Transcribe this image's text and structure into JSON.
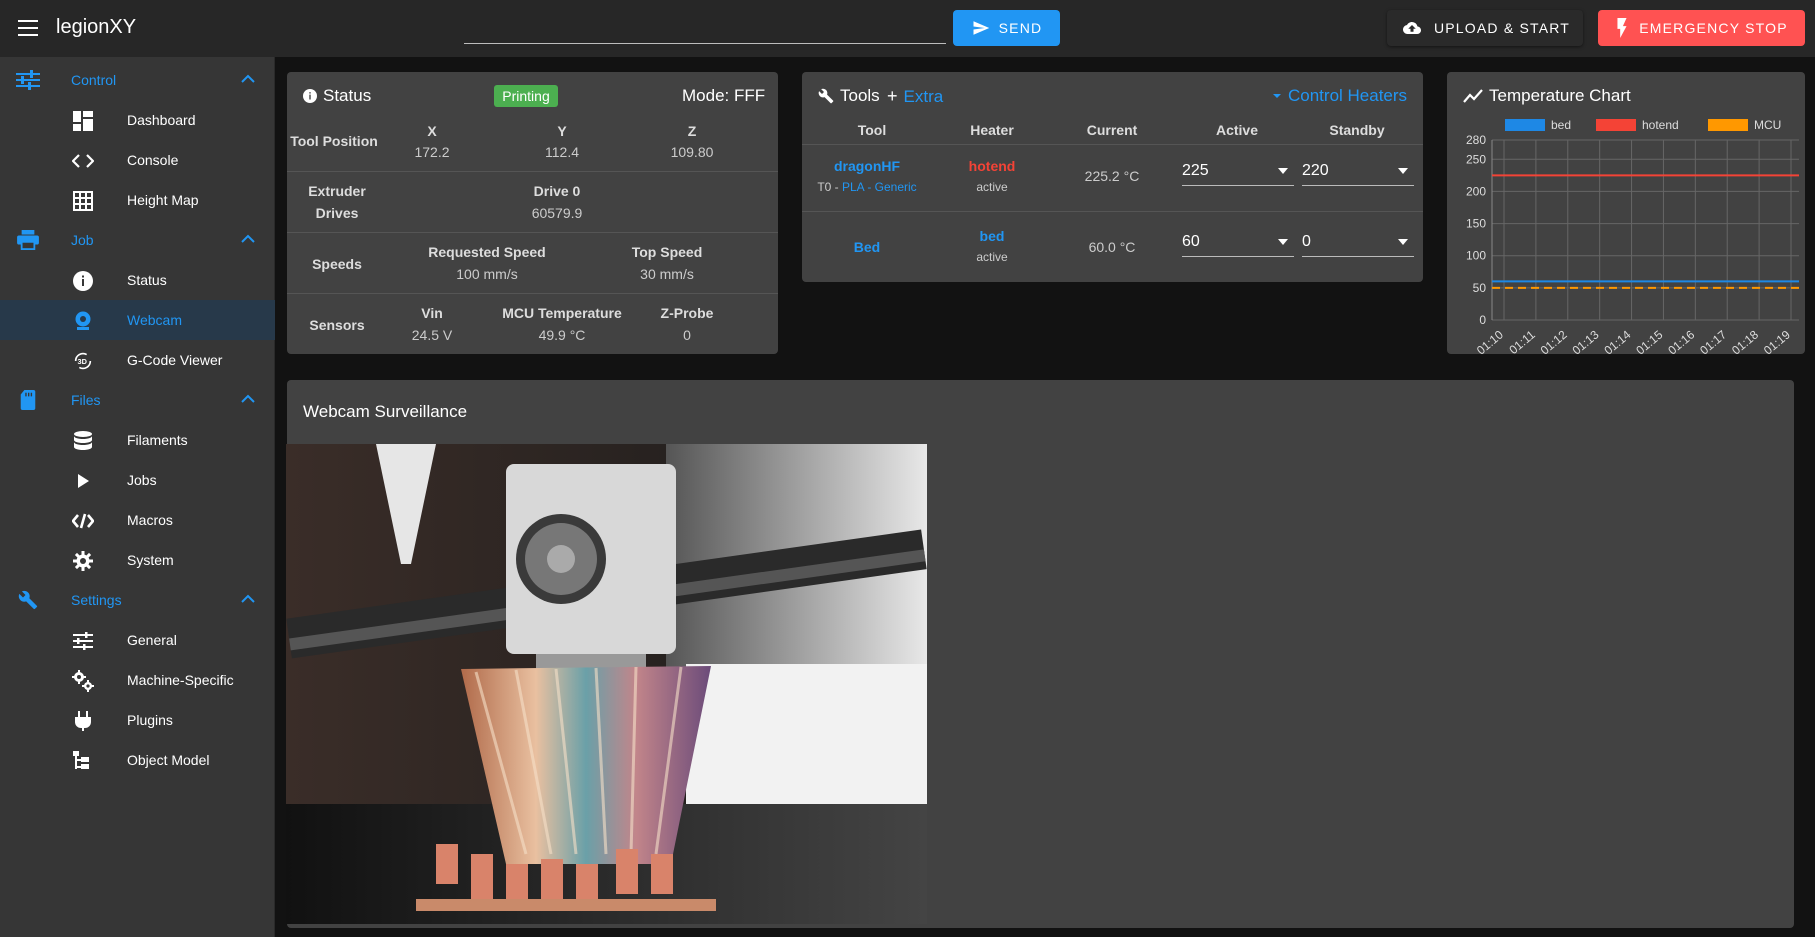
{
  "app": {
    "title": "legionXY"
  },
  "topbar": {
    "command_placeholder": "",
    "send_label": "SEND",
    "upload_label": "UPLOAD & START",
    "estop_label": "EMERGENCY STOP"
  },
  "sidebar": {
    "groups": [
      {
        "label": "Control",
        "icon": "tune-icon",
        "items": [
          "Dashboard",
          "Console",
          "Height Map"
        ]
      },
      {
        "label": "Job",
        "icon": "printer-icon",
        "items": [
          "Status",
          "Webcam",
          "G-Code Viewer"
        ]
      },
      {
        "label": "Files",
        "icon": "sd-card-icon",
        "items": [
          "Filaments",
          "Jobs",
          "Macros",
          "System"
        ]
      },
      {
        "label": "Settings",
        "icon": "wrench-icon",
        "items": [
          "General",
          "Machine-Specific",
          "Plugins",
          "Object Model"
        ]
      }
    ],
    "active_item": "Webcam"
  },
  "status": {
    "title": "Status",
    "state": "Printing",
    "mode": "Mode: FFF",
    "tool_position_label": "Tool Position",
    "axes": [
      {
        "name": "X",
        "value": "172.2"
      },
      {
        "name": "Y",
        "value": "112.4"
      },
      {
        "name": "Z",
        "value": "109.80"
      }
    ],
    "extruder_label_1": "Extruder",
    "extruder_label_2": "Drives",
    "drive_name": "Drive 0",
    "drive_value": "60579.9",
    "speeds_label": "Speeds",
    "requested_speed_label": "Requested Speed",
    "requested_speed_value": "100 mm/s",
    "top_speed_label": "Top Speed",
    "top_speed_value": "30 mm/s",
    "sensors_label": "Sensors",
    "vin_label": "Vin",
    "vin_value": "24.5 V",
    "mcu_label": "MCU Temperature",
    "mcu_value": "49.9 °C",
    "zprobe_label": "Z-Probe",
    "zprobe_value": "0"
  },
  "tools": {
    "title": "Tools",
    "extra_label": "Extra",
    "control_heaters_label": "Control Heaters",
    "headers": {
      "tool": "Tool",
      "heater": "Heater",
      "current": "Current",
      "active": "Active",
      "standby": "Standby"
    },
    "rows": [
      {
        "tool": "dragonHF",
        "tool_sub_prefix": "T0 - ",
        "tool_sub_link": "PLA - Generic",
        "heater": "hotend",
        "heater_state": "active",
        "current": "225.2 °C",
        "active": "225",
        "standby": "220"
      },
      {
        "tool": "Bed",
        "heater": "bed",
        "heater_state": "active",
        "current": "60.0 °C",
        "active": "60",
        "standby": "0"
      }
    ]
  },
  "temperature_chart": {
    "title": "Temperature Chart"
  },
  "chart_data": {
    "type": "line",
    "title": "Temperature Chart",
    "x": [
      "01:10",
      "01:11",
      "01:12",
      "01:13",
      "01:14",
      "01:15",
      "01:16",
      "01:17",
      "01:18",
      "01:19"
    ],
    "series": [
      {
        "name": "bed",
        "color": "#1e88e5",
        "values": [
          60,
          60,
          60,
          60,
          60,
          60,
          60,
          60,
          60,
          60
        ]
      },
      {
        "name": "hotend",
        "color": "#f44336",
        "values": [
          225,
          225,
          225,
          225,
          225,
          225,
          225,
          225,
          225,
          225
        ]
      },
      {
        "name": "MCU",
        "color": "#ff9800",
        "values": [
          50,
          50,
          50,
          50,
          50,
          50,
          50,
          50,
          50,
          50
        ]
      }
    ],
    "yticks": [
      0,
      50,
      100,
      150,
      200,
      250,
      280
    ],
    "ylim": [
      0,
      280
    ],
    "legend": "top",
    "grid": true
  },
  "webcam": {
    "title": "Webcam Surveillance"
  }
}
